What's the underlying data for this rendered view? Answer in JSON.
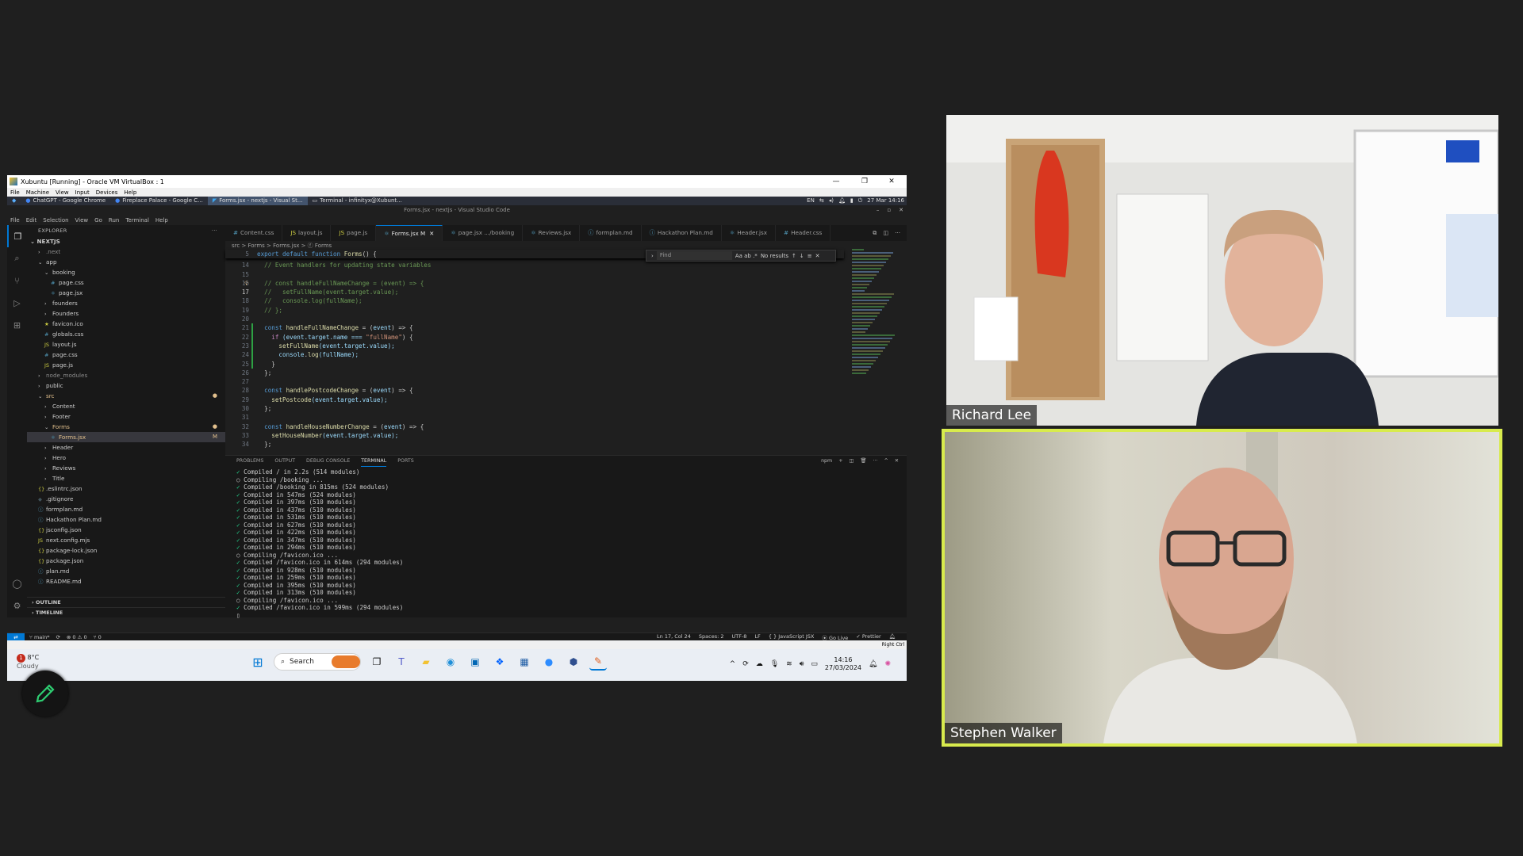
{
  "vbox": {
    "title": "Xubuntu [Running] - Oracle VM VirtualBox : 1",
    "controls": [
      "—",
      "❐",
      "✕"
    ],
    "menu": [
      "File",
      "Machine",
      "View",
      "Input",
      "Devices",
      "Help"
    ],
    "right_ctrl": "Right Ctrl"
  },
  "xfce": {
    "tasks": [
      "ChatGPT - Google Chrome",
      "Fireplace Palace - Google C...",
      "Forms.jsx - nextjs - Visual St...",
      "Terminal - infinityx@Xubunt..."
    ],
    "lang": "EN",
    "datetime": "27 Mar 14:16"
  },
  "vscode": {
    "window_title": "Forms.jsx - nextjs - Visual Studio Code",
    "menu": [
      "File",
      "Edit",
      "Selection",
      "View",
      "Go",
      "Run",
      "Terminal",
      "Help"
    ],
    "explorer_label": "EXPLORER",
    "project": "NEXTJS",
    "tree": [
      {
        "label": ".next",
        "indent": 1,
        "kind": "chevron-right",
        "color": "#8b8b8b"
      },
      {
        "label": "app",
        "indent": 1,
        "kind": "chevron-down",
        "color": "#cccccc"
      },
      {
        "label": "booking",
        "indent": 2,
        "kind": "chevron-down",
        "color": "#cccccc"
      },
      {
        "label": "page.css",
        "indent": 3,
        "kind": "css",
        "color": "#cccccc"
      },
      {
        "label": "page.jsx",
        "indent": 3,
        "kind": "react",
        "color": "#cccccc"
      },
      {
        "label": "founders",
        "indent": 2,
        "kind": "chevron-right",
        "color": "#cccccc"
      },
      {
        "label": "Founders",
        "indent": 2,
        "kind": "chevron-right",
        "color": "#cccccc"
      },
      {
        "label": "favicon.ico",
        "indent": 2,
        "kind": "star",
        "color": "#cccccc"
      },
      {
        "label": "globals.css",
        "indent": 2,
        "kind": "css",
        "color": "#cccccc"
      },
      {
        "label": "layout.js",
        "indent": 2,
        "kind": "js",
        "color": "#cccccc"
      },
      {
        "label": "page.css",
        "indent": 2,
        "kind": "css",
        "color": "#cccccc"
      },
      {
        "label": "page.js",
        "indent": 2,
        "kind": "js",
        "color": "#cccccc"
      },
      {
        "label": "node_modules",
        "indent": 1,
        "kind": "chevron-right",
        "color": "#8b8b8b"
      },
      {
        "label": "public",
        "indent": 1,
        "kind": "chevron-right",
        "color": "#cccccc"
      },
      {
        "label": "src",
        "indent": 1,
        "kind": "chevron-down",
        "color": "#e2c08d",
        "badge": "●"
      },
      {
        "label": "Content",
        "indent": 2,
        "kind": "chevron-right",
        "color": "#cccccc"
      },
      {
        "label": "Footer",
        "indent": 2,
        "kind": "chevron-right",
        "color": "#cccccc"
      },
      {
        "label": "Forms",
        "indent": 2,
        "kind": "chevron-down",
        "color": "#e2c08d",
        "badge": "●"
      },
      {
        "label": "Forms.jsx",
        "indent": 3,
        "kind": "react",
        "color": "#e2c08d",
        "badge": "M",
        "selected": true
      },
      {
        "label": "Header",
        "indent": 2,
        "kind": "chevron-right",
        "color": "#cccccc"
      },
      {
        "label": "Hero",
        "indent": 2,
        "kind": "chevron-right",
        "color": "#cccccc"
      },
      {
        "label": "Reviews",
        "indent": 2,
        "kind": "chevron-right",
        "color": "#cccccc"
      },
      {
        "label": "Title",
        "indent": 2,
        "kind": "chevron-right",
        "color": "#cccccc"
      },
      {
        "label": ".eslintrc.json",
        "indent": 1,
        "kind": "brace",
        "color": "#cccccc"
      },
      {
        "label": ".gitignore",
        "indent": 1,
        "kind": "git",
        "color": "#cccccc"
      },
      {
        "label": "formplan.md",
        "indent": 1,
        "kind": "md",
        "color": "#cccccc"
      },
      {
        "label": "Hackathon Plan.md",
        "indent": 1,
        "kind": "md",
        "color": "#cccccc"
      },
      {
        "label": "jsconfig.json",
        "indent": 1,
        "kind": "brace",
        "color": "#cccccc"
      },
      {
        "label": "next.config.mjs",
        "indent": 1,
        "kind": "js",
        "color": "#cccccc"
      },
      {
        "label": "package-lock.json",
        "indent": 1,
        "kind": "brace",
        "color": "#cccccc"
      },
      {
        "label": "package.json",
        "indent": 1,
        "kind": "brace",
        "color": "#cccccc"
      },
      {
        "label": "plan.md",
        "indent": 1,
        "kind": "md",
        "color": "#cccccc"
      },
      {
        "label": "README.md",
        "indent": 1,
        "kind": "md",
        "color": "#cccccc"
      }
    ],
    "outline_label": "OUTLINE",
    "timeline_label": "TIMELINE",
    "tabs": [
      {
        "label": "Content.css",
        "icon": "#",
        "icon_color": "#519aba"
      },
      {
        "label": "layout.js",
        "icon": "JS",
        "icon_color": "#cbcb41"
      },
      {
        "label": "page.js",
        "icon": "JS",
        "icon_color": "#cbcb41"
      },
      {
        "label": "Forms.jsx M",
        "icon": "⚛",
        "icon_color": "#519aba",
        "active": true
      },
      {
        "label": "page.jsx .../booking",
        "icon": "⚛",
        "icon_color": "#519aba"
      },
      {
        "label": "Reviews.jsx",
        "icon": "⚛",
        "icon_color": "#519aba"
      },
      {
        "label": "formplan.md",
        "icon": "ⓘ",
        "icon_color": "#519aba"
      },
      {
        "label": "Hackathon Plan.md",
        "icon": "ⓘ",
        "icon_color": "#519aba"
      },
      {
        "label": "Header.jsx",
        "icon": "⚛",
        "icon_color": "#519aba"
      },
      {
        "label": "Header.css",
        "icon": "#",
        "icon_color": "#519aba"
      }
    ],
    "breadcrumb": "src > Forms > Forms.jsx > ⓕ Forms",
    "find": {
      "placeholder": "Find",
      "result": "No results",
      "options": "Aa ab .*"
    },
    "code_lines": [
      {
        "n": "5",
        "tokens": [
          [
            "export default function ",
            "#569cd6"
          ],
          [
            "Forms",
            "#dcdcaa"
          ],
          [
            "() {",
            "#cccccc"
          ]
        ]
      },
      {
        "n": "14",
        "tokens": [
          [
            "  // Event handlers for updating state variables",
            "#6a9955"
          ]
        ]
      },
      {
        "n": "15",
        "tokens": [
          [
            "",
            "#cccccc"
          ]
        ]
      },
      {
        "n": "16",
        "tokens": [
          [
            "  // const handleFullNameChange = (event) => {",
            "#6a9955"
          ]
        ],
        "bulb": true
      },
      {
        "n": "17",
        "tokens": [
          [
            "  //   setFullName(event.target.value);",
            "#6a9955"
          ]
        ],
        "current": true
      },
      {
        "n": "18",
        "tokens": [
          [
            "  //   console.log(fullName);",
            "#6a9955"
          ]
        ]
      },
      {
        "n": "19",
        "tokens": [
          [
            "  // };",
            "#6a9955"
          ]
        ]
      },
      {
        "n": "20",
        "tokens": [
          [
            "",
            "#cccccc"
          ]
        ]
      },
      {
        "n": "21",
        "tokens": [
          [
            "  const ",
            "#569cd6"
          ],
          [
            "handleFullNameChange",
            "#dcdcaa"
          ],
          [
            " = (",
            "#cccccc"
          ],
          [
            "event",
            "#9cdcfe"
          ],
          [
            ") => {",
            "#cccccc"
          ]
        ],
        "mod": true
      },
      {
        "n": "22",
        "tokens": [
          [
            "    if ",
            "#c586c0"
          ],
          [
            "(event.target.name === ",
            "#9cdcfe"
          ],
          [
            "\"fullName\"",
            "#ce9178"
          ],
          [
            ") {",
            "#cccccc"
          ]
        ],
        "mod": true
      },
      {
        "n": "23",
        "tokens": [
          [
            "      setFullName",
            "#dcdcaa"
          ],
          [
            "(event.target.value);",
            "#9cdcfe"
          ]
        ],
        "mod": true
      },
      {
        "n": "24",
        "tokens": [
          [
            "      console",
            "#9cdcfe"
          ],
          [
            ".",
            "#cccccc"
          ],
          [
            "log",
            "#dcdcaa"
          ],
          [
            "(fullName);",
            "#9cdcfe"
          ]
        ],
        "mod": true
      },
      {
        "n": "25",
        "tokens": [
          [
            "    }",
            "#cccccc"
          ]
        ],
        "mod": true
      },
      {
        "n": "26",
        "tokens": [
          [
            "  };",
            "#cccccc"
          ]
        ]
      },
      {
        "n": "27",
        "tokens": [
          [
            "",
            "#cccccc"
          ]
        ]
      },
      {
        "n": "28",
        "tokens": [
          [
            "  const ",
            "#569cd6"
          ],
          [
            "handlePostcodeChange",
            "#dcdcaa"
          ],
          [
            " = (",
            "#cccccc"
          ],
          [
            "event",
            "#9cdcfe"
          ],
          [
            ") => {",
            "#cccccc"
          ]
        ]
      },
      {
        "n": "29",
        "tokens": [
          [
            "    setPostcode",
            "#dcdcaa"
          ],
          [
            "(event.target.value);",
            "#9cdcfe"
          ]
        ]
      },
      {
        "n": "30",
        "tokens": [
          [
            "  };",
            "#cccccc"
          ]
        ]
      },
      {
        "n": "31",
        "tokens": [
          [
            "",
            "#cccccc"
          ]
        ]
      },
      {
        "n": "32",
        "tokens": [
          [
            "  const ",
            "#569cd6"
          ],
          [
            "handleHouseNumberChange",
            "#dcdcaa"
          ],
          [
            " = (",
            "#cccccc"
          ],
          [
            "event",
            "#9cdcfe"
          ],
          [
            ") => {",
            "#cccccc"
          ]
        ]
      },
      {
        "n": "33",
        "tokens": [
          [
            "    setHouseNumber",
            "#dcdcaa"
          ],
          [
            "(event.target.value);",
            "#9cdcfe"
          ]
        ]
      },
      {
        "n": "34",
        "tokens": [
          [
            "  };",
            "#cccccc"
          ]
        ]
      }
    ],
    "panel_tabs": [
      "PROBLEMS",
      "OUTPUT",
      "DEBUG CONSOLE",
      "TERMINAL",
      "PORTS"
    ],
    "panel_active": "TERMINAL",
    "panel_right": "npm",
    "terminal_lines": [
      "✓ Compiled / in 2.2s (514 modules)",
      "○ Compiling /booking ...",
      "✓ Compiled /booking in 815ms (524 modules)",
      "✓ Compiled in 547ms (524 modules)",
      "✓ Compiled in 397ms (510 modules)",
      "✓ Compiled in 437ms (510 modules)",
      "✓ Compiled in 531ms (510 modules)",
      "✓ Compiled in 627ms (510 modules)",
      "✓ Compiled in 422ms (510 modules)",
      "✓ Compiled in 347ms (510 modules)",
      "✓ Compiled in 294ms (510 modules)",
      "○ Compiling /favicon.ico ...",
      "✓ Compiled /favicon.ico in 614ms (294 modules)",
      "✓ Compiled in 928ms (510 modules)",
      "✓ Compiled in 259ms (510 modules)",
      "✓ Compiled in 395ms (510 modules)",
      "✓ Compiled in 313ms (510 modules)",
      "○ Compiling /favicon.ico ...",
      "✓ Compiled /favicon.ico in 599ms (294 modules)",
      "▯"
    ],
    "status": {
      "branch": "main*",
      "problems": "⊗ 0 ⚠ 0",
      "ports": "⑂ 0",
      "position": "Ln 17, Col 24",
      "spaces": "Spaces: 2",
      "encoding": "UTF-8",
      "eol": "LF",
      "language": "{ } JavaScript JSX",
      "golive": "Go Live",
      "prettier": "✓ Prettier"
    }
  },
  "windows": {
    "weather_temp": "8°C",
    "weather_badge": "1",
    "weather_desc": "Cloudy",
    "search_placeholder": "Search",
    "time": "14:16",
    "date": "27/03/2024"
  },
  "participants": [
    {
      "name": "Richard Lee"
    },
    {
      "name": "Stephen Walker",
      "speaking": true
    }
  ],
  "colors": {
    "speaking_border": "#d8eb4d",
    "accent": "#0078d4"
  }
}
